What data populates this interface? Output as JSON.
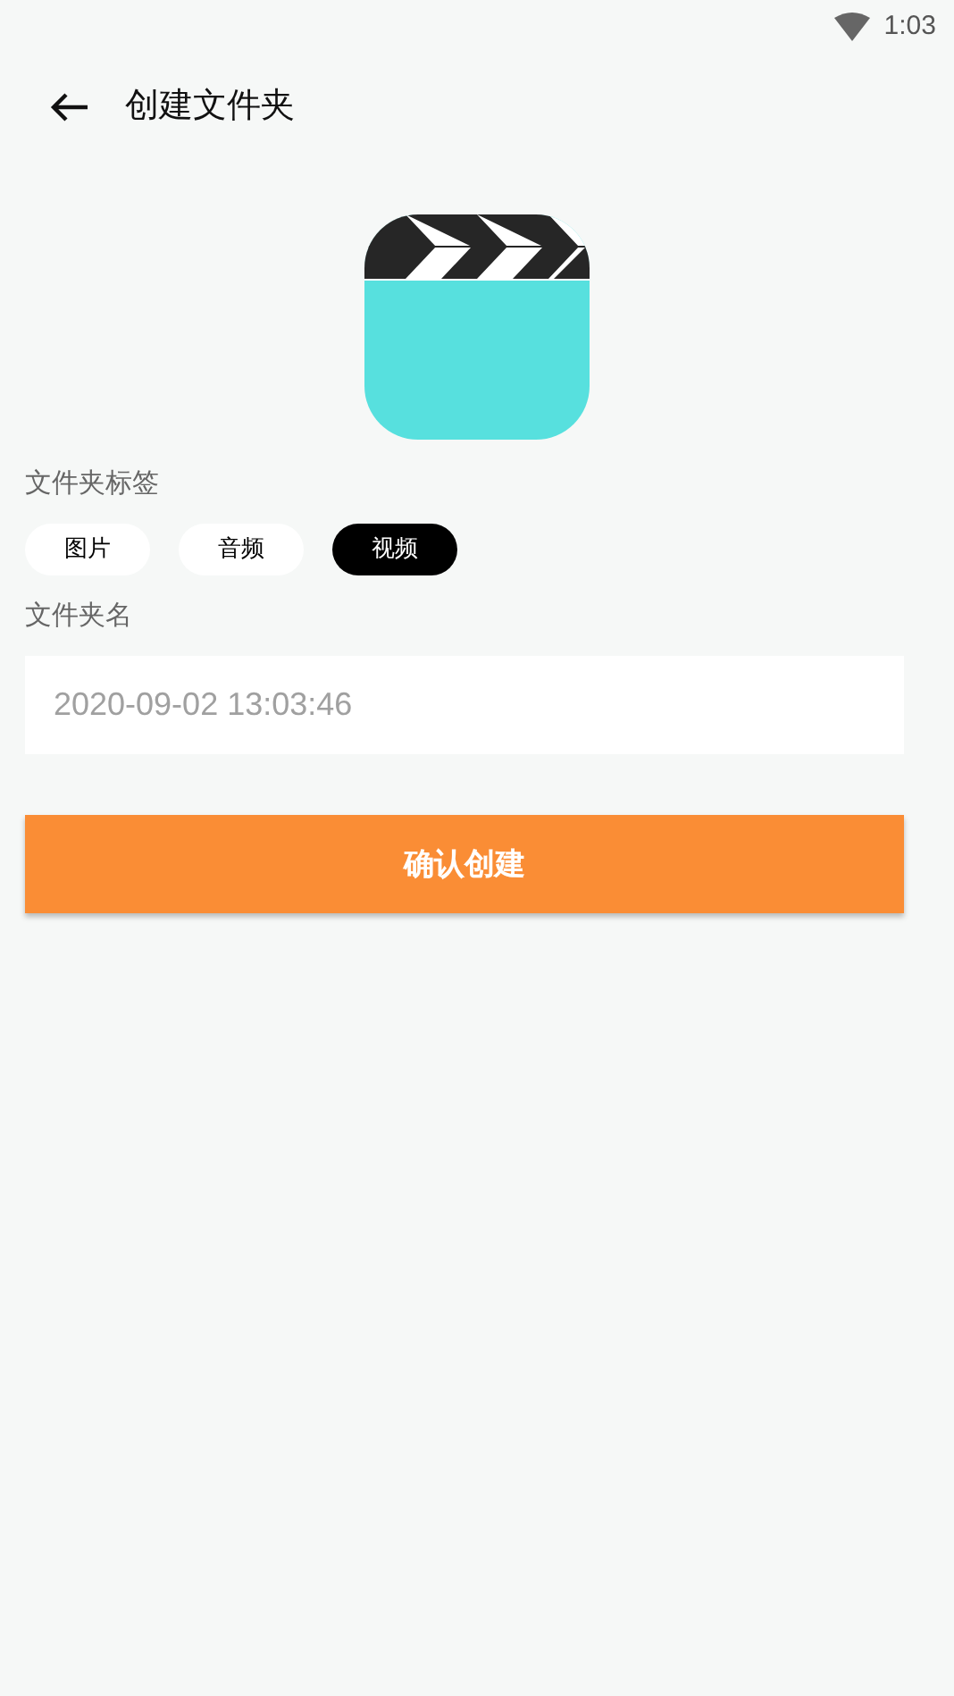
{
  "status_bar": {
    "time": "1:03"
  },
  "header": {
    "title": "创建文件夹"
  },
  "tags": {
    "label": "文件夹标签",
    "items": [
      {
        "label": "图片",
        "selected": false
      },
      {
        "label": "音频",
        "selected": false
      },
      {
        "label": "视频",
        "selected": true
      }
    ]
  },
  "name_field": {
    "label": "文件夹名",
    "placeholder": "2020-09-02 13:03:46"
  },
  "confirm_button": {
    "label": "确认创建"
  }
}
